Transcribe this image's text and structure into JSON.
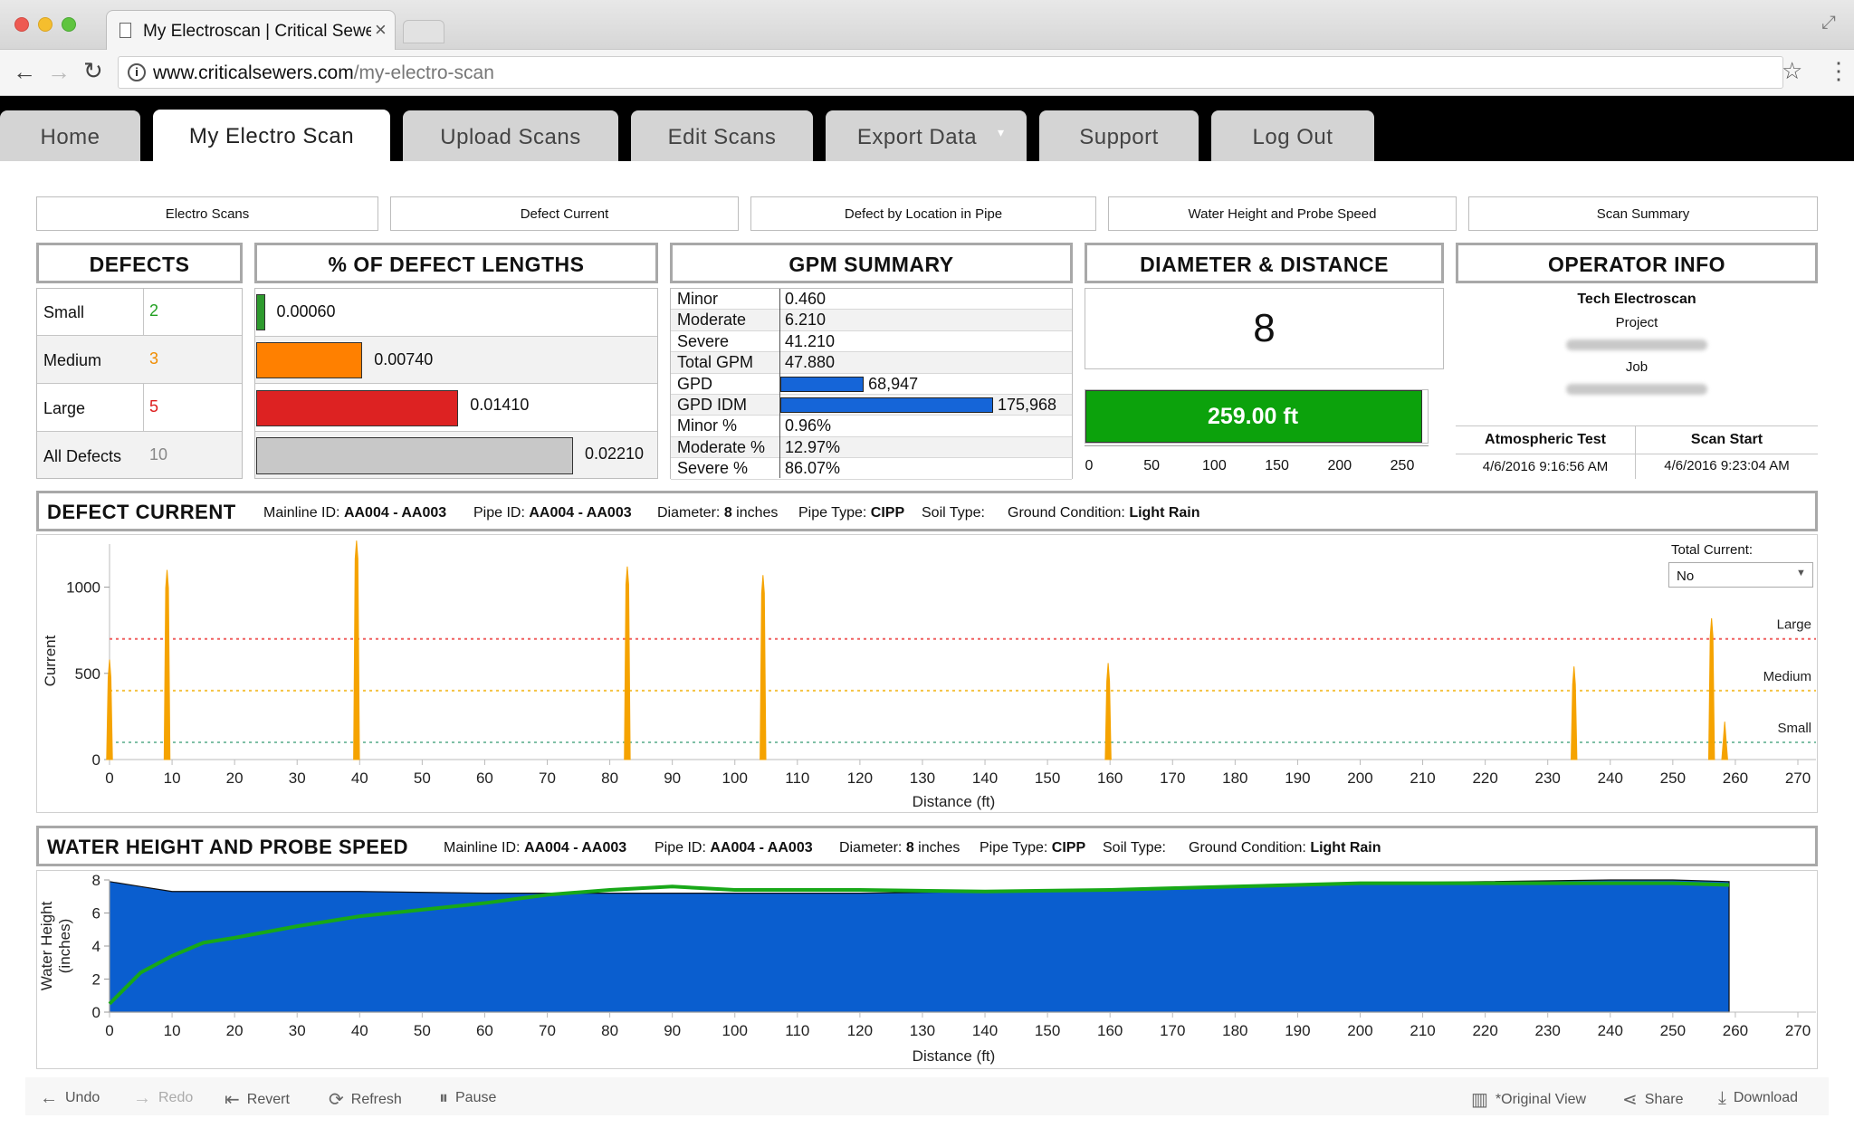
{
  "browser": {
    "tab_title": "My Electroscan | Critical Sewers",
    "url_host": "www.criticalsewers.com",
    "url_path": "/my-electro-scan"
  },
  "nav": {
    "tabs": [
      {
        "label": "Home"
      },
      {
        "label": "My Electro Scan"
      },
      {
        "label": "Upload Scans"
      },
      {
        "label": "Edit Scans"
      },
      {
        "label": "Export Data"
      },
      {
        "label": "Support"
      },
      {
        "label": "Log Out"
      }
    ],
    "active": "My Electro Scan"
  },
  "subnav": [
    "Electro Scans",
    "Defect Current",
    "Defect by Location in Pipe",
    "Water Height and Probe Speed",
    "Scan Summary"
  ],
  "defects": {
    "title": "DEFECTS",
    "rows": [
      {
        "label": "Small",
        "count": "2",
        "color": "#22a022"
      },
      {
        "label": "Medium",
        "count": "3",
        "color": "#f08c00"
      },
      {
        "label": "Large",
        "count": "5",
        "color": "#dd1c1c"
      },
      {
        "label": "All Defects",
        "count": "10",
        "color": "#888888"
      }
    ]
  },
  "defect_lengths": {
    "title": "% OF DEFECT LENGTHS",
    "bars": [
      {
        "label": "0.00060",
        "value": 0.0006,
        "color": "#2e9a2e"
      },
      {
        "label": "0.00740",
        "value": 0.0074,
        "color": "#ff8000"
      },
      {
        "label": "0.01410",
        "value": 0.0141,
        "color": "#dd2222"
      },
      {
        "label": "0.02210",
        "value": 0.0221,
        "color": "#c8c8c8"
      }
    ]
  },
  "gpm_summary": {
    "title": "GPM SUMMARY",
    "rows": [
      {
        "label": "Minor",
        "value": "0.460"
      },
      {
        "label": "Moderate",
        "value": "6.210"
      },
      {
        "label": "Severe",
        "value": "41.210"
      },
      {
        "label": "Total GPM",
        "value": "47.880"
      },
      {
        "label": "GPD",
        "value": "68,947",
        "bar": 68947
      },
      {
        "label": "GPD IDM",
        "value": "175,968",
        "bar": 175968
      },
      {
        "label": "Minor %",
        "value": "0.96%"
      },
      {
        "label": "Moderate %",
        "value": "12.97%"
      },
      {
        "label": "Severe %",
        "value": "86.07%"
      }
    ],
    "bar_color": "#1565d8"
  },
  "diameter_distance": {
    "title": "DIAMETER & DISTANCE",
    "diameter": "8",
    "distance_label": "259.00 ft",
    "distance_value": 259,
    "scale_max": 259,
    "ticks": [
      "0",
      "50",
      "100",
      "150",
      "200",
      "250"
    ],
    "bar_color": "#0ca20c"
  },
  "operator_info": {
    "title": "OPERATOR INFO",
    "operator": "Tech Electroscan",
    "project_label": "Project",
    "job_label": "Job",
    "atmospheric_test_label": "Atmospheric Test",
    "atmospheric_test_value": "4/6/2016 9:16:56 AM",
    "scan_start_label": "Scan Start",
    "scan_start_value": "4/6/2016 9:23:04 AM"
  },
  "defect_current": {
    "title": "DEFECT CURRENT",
    "mainline_label": "Mainline ID:",
    "mainline": "AA004 - AA003",
    "pipe_label": "Pipe ID:",
    "pipe": "AA004 - AA003",
    "diameter_label": "Diameter:",
    "diameter": "8",
    "diameter_unit": "inches",
    "pipetype_label": "Pipe Type:",
    "pipetype": "CIPP",
    "soil_label": "Soil Type:",
    "ground_label": "Ground Condition:",
    "ground": "Light Rain",
    "total_current_label": "Total Current:",
    "total_current_value": "No"
  },
  "water_height": {
    "title": "WATER HEIGHT AND PROBE SPEED",
    "mainline_label": "Mainline ID:",
    "mainline": "AA004 - AA003",
    "pipe_label": "Pipe ID:",
    "pipe": "AA004 - AA003",
    "diameter_label": "Diameter:",
    "diameter": "8",
    "diameter_unit": "inches",
    "pipetype_label": "Pipe Type:",
    "pipetype": "CIPP",
    "soil_label": "Soil Type:",
    "ground_label": "Ground Condition:",
    "ground": "Light Rain"
  },
  "chart_data": [
    {
      "type": "line",
      "xlabel": "Distance (ft)",
      "ylabel": "Current",
      "xlim": [
        0,
        270
      ],
      "ylim": [
        0,
        1250
      ],
      "xticks": [
        0,
        10,
        20,
        30,
        40,
        50,
        60,
        70,
        80,
        90,
        100,
        110,
        120,
        130,
        140,
        150,
        160,
        170,
        180,
        190,
        200,
        210,
        220,
        230,
        240,
        250,
        260,
        270
      ],
      "yticks": [
        0,
        500,
        1000
      ],
      "series": [
        {
          "color": "#f5a300",
          "peaks": [
            {
              "x": 0,
              "y": 580
            },
            {
              "x": 9.2,
              "y": 1100
            },
            {
              "x": 39.5,
              "y": 1270
            },
            {
              "x": 82.8,
              "y": 1120
            },
            {
              "x": 104.5,
              "y": 1070
            },
            {
              "x": 159.7,
              "y": 560
            },
            {
              "x": 234.2,
              "y": 540
            },
            {
              "x": 256.2,
              "y": 820
            },
            {
              "x": 258.3,
              "y": 220
            }
          ]
        }
      ],
      "thresholds": [
        {
          "name": "Large",
          "y": 700,
          "color": "#f06060"
        },
        {
          "name": "Medium",
          "y": 400,
          "color": "#f5c242"
        },
        {
          "name": "Small",
          "y": 100,
          "color": "#7fbfa6"
        }
      ]
    },
    {
      "type": "area",
      "xlabel": "Distance (ft)",
      "ylabel": "Water Height (inches)",
      "xlim": [
        0,
        270
      ],
      "ylim": [
        0,
        8
      ],
      "xticks": [
        0,
        10,
        20,
        30,
        40,
        50,
        60,
        70,
        80,
        90,
        100,
        110,
        120,
        130,
        140,
        150,
        160,
        170,
        180,
        190,
        200,
        210,
        220,
        230,
        240,
        250,
        260,
        270
      ],
      "yticks": [
        0,
        2,
        4,
        6,
        8
      ],
      "series": [
        {
          "color": "#0a5ecf",
          "x": [
            0,
            5,
            10,
            20,
            40,
            60,
            80,
            100,
            120,
            140,
            160,
            180,
            200,
            220,
            240,
            250,
            259
          ],
          "y": [
            7.9,
            7.6,
            7.3,
            7.3,
            7.3,
            7.2,
            7.2,
            7.2,
            7.2,
            7.3,
            7.4,
            7.6,
            7.8,
            7.9,
            8.0,
            8.0,
            7.9
          ]
        },
        {
          "color": "#18a818",
          "x": [
            0,
            5,
            10,
            15,
            20,
            30,
            40,
            50,
            60,
            70,
            80,
            90,
            100,
            120,
            140,
            160,
            180,
            200,
            220,
            240,
            250,
            259
          ],
          "y": [
            0.5,
            2.4,
            3.4,
            4.2,
            4.5,
            5.2,
            5.8,
            6.2,
            6.6,
            7.1,
            7.4,
            7.6,
            7.4,
            7.4,
            7.3,
            7.4,
            7.6,
            7.8,
            7.8,
            7.8,
            7.8,
            7.7
          ]
        }
      ]
    }
  ],
  "toolbar": {
    "undo": "Undo",
    "redo": "Redo",
    "revert": "Revert",
    "refresh": "Refresh",
    "pause": "Pause",
    "original_view": "*Original View",
    "share": "Share",
    "download": "Download"
  }
}
